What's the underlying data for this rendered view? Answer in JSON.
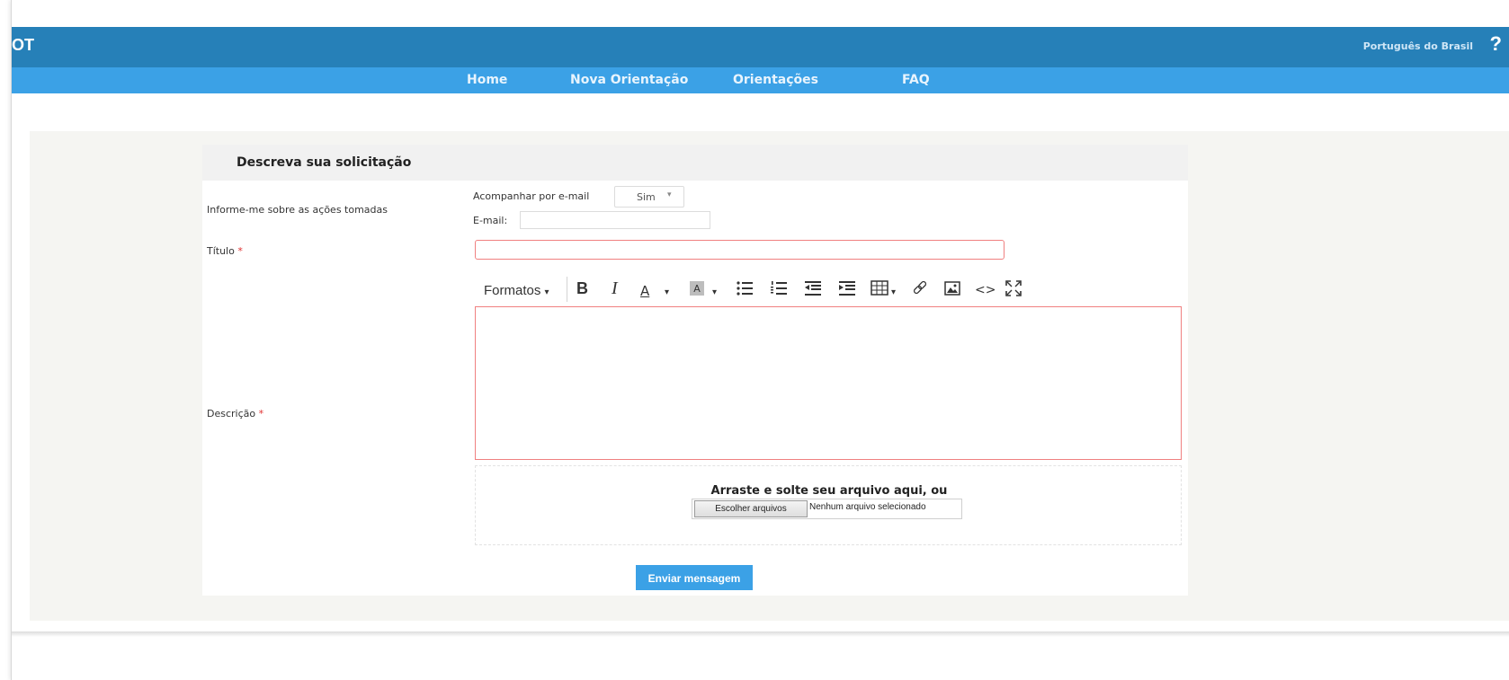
{
  "header": {
    "app_name": "OT",
    "language_link": "Português do Brasil",
    "help_symbol": "?"
  },
  "nav": {
    "items": [
      {
        "label": "Home"
      },
      {
        "label": "Nova Orientação"
      },
      {
        "label": "Orientações"
      },
      {
        "label": "FAQ"
      }
    ]
  },
  "form": {
    "title": "Descreva sua solicitação",
    "notify_label": "Informe-me sobre as ações tomadas",
    "follow_email_label": "Acompanhar por e-mail",
    "follow_email_value": "Sim",
    "email_label": "E-mail:",
    "email_value": "",
    "titulo_label": "Título",
    "required_mark": "*",
    "titulo_value": "",
    "descricao_label": "Descrição",
    "editor": {
      "formats_label": "Formatos",
      "dropdown_caret": "▾",
      "tools": [
        "bold-icon",
        "italic-icon",
        "font-color-icon",
        "background-color-icon",
        "bullet-list-icon",
        "numbered-list-icon",
        "outdent-icon",
        "indent-icon",
        "table-icon",
        "link-icon",
        "image-icon",
        "code-icon",
        "fullscreen-icon"
      ]
    },
    "dropzone": {
      "text": "Arraste e solte seu arquivo aqui, ou",
      "choose_button": "Escolher arquivos",
      "no_file_text": "Nenhum arquivo selecionado"
    },
    "submit_label": "Enviar mensagem"
  },
  "colors": {
    "topbar": "#2680b8",
    "navbar": "#3ba1e6",
    "required": "#e03030",
    "invalid_border": "#f08080"
  }
}
